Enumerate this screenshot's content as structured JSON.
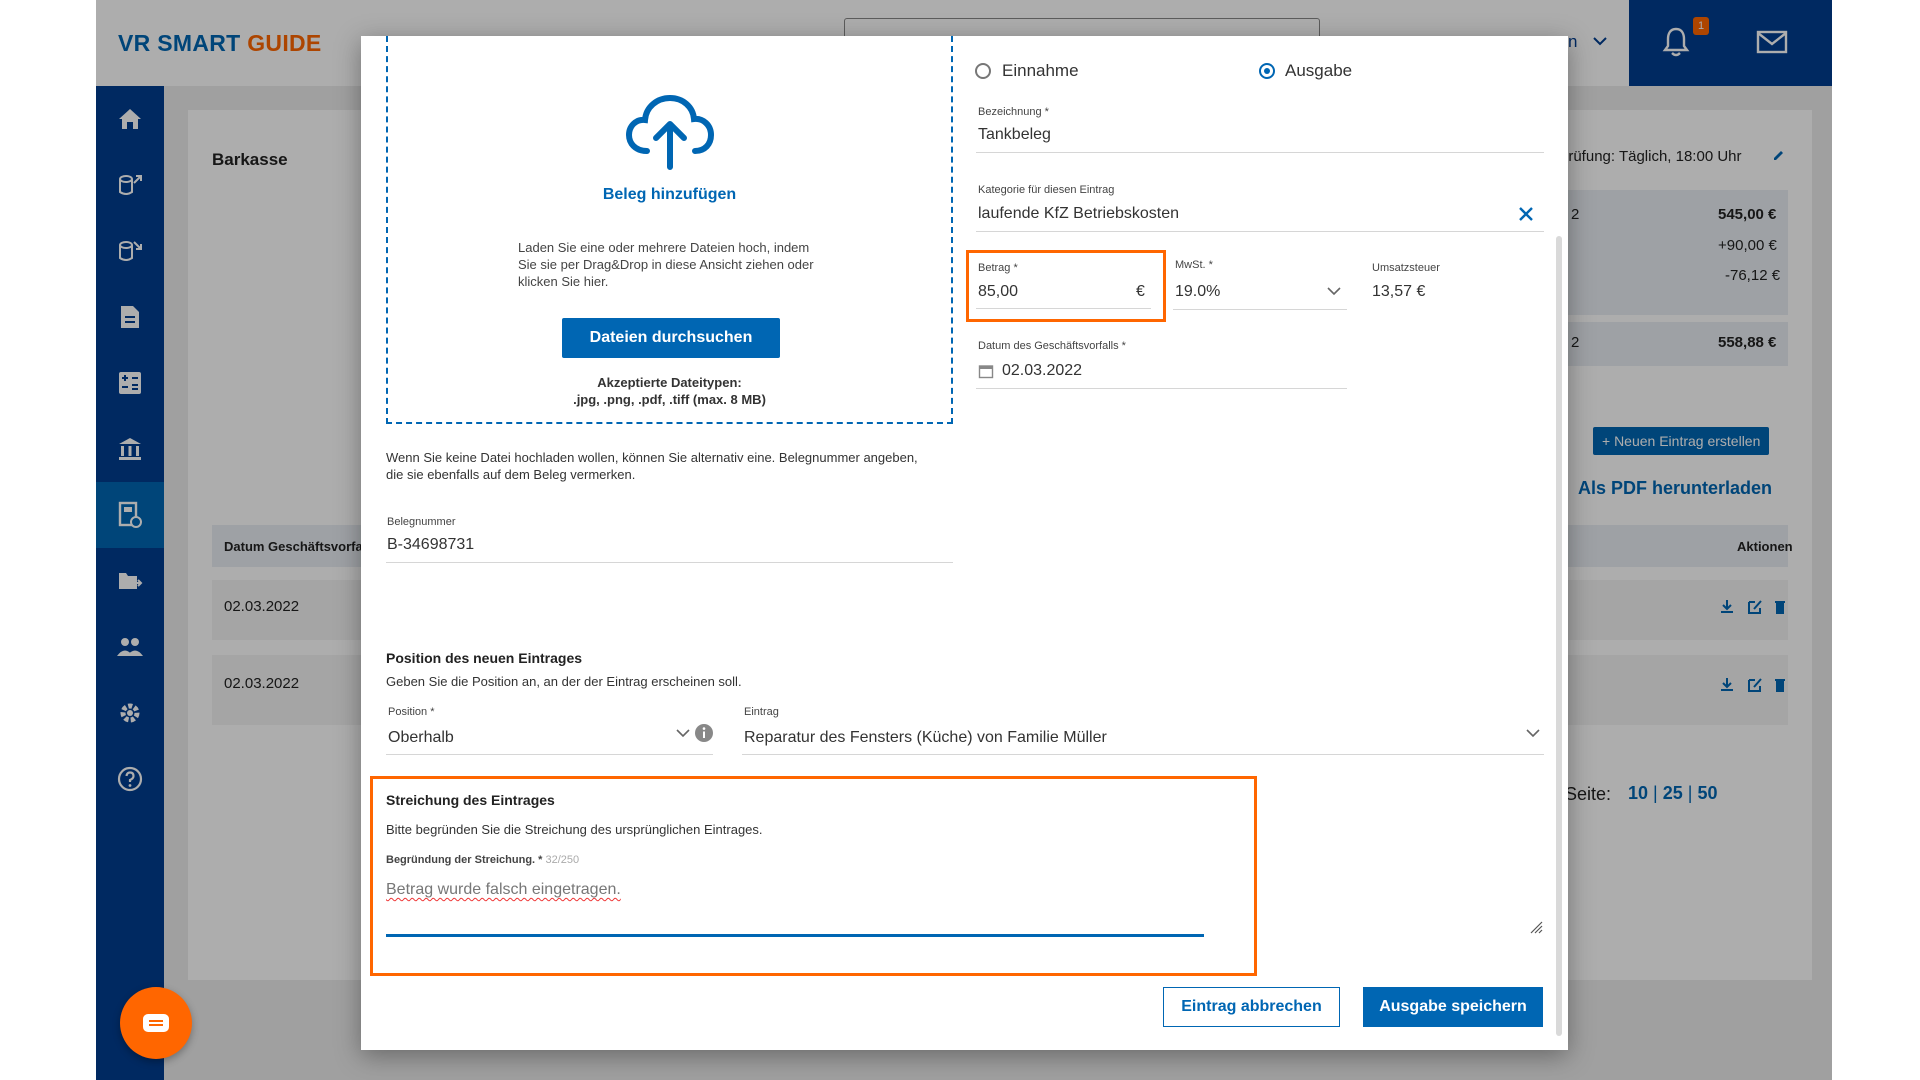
{
  "app": {
    "logo_part1": "VR SMART",
    "logo_part2": "GUIDE",
    "user_truncated": "n",
    "notification_count": "1"
  },
  "background": {
    "page_title": "Barkasse",
    "review_text": "prüfung: Täglich, 18:00 Uhr",
    "summary": [
      {
        "marker": "2",
        "value": "545,00 €"
      },
      {
        "marker": "",
        "value": "+90,00 €"
      },
      {
        "marker": "",
        "value": "-76,12 €"
      },
      {
        "marker": "2",
        "value": "558,88 €"
      }
    ],
    "new_entry_button": "+ Neuen Eintrag erstellen",
    "pdf_link": "Als PDF herunterladen",
    "table_header_date": "Datum Geschäftsvorfal",
    "table_header_actions": "Aktionen",
    "rows": [
      {
        "date": "02.03.2022"
      },
      {
        "date": "02.03.2022"
      }
    ],
    "pagination_label": "Seite:",
    "page_sizes": [
      "10",
      "25",
      "50"
    ]
  },
  "modal": {
    "upload": {
      "title": "Beleg hinzufügen",
      "description": "Laden Sie eine oder mehrere Dateien hoch, indem Sie sie per Drag&Drop in diese Ansicht ziehen oder klicken Sie hier.",
      "browse_button": "Dateien durchsuchen",
      "accepted_title": "Akzeptierte Dateitypen:",
      "accepted_types": ".jpg, .png, .pdf, .tiff (max. 8 MB)"
    },
    "alt_note": "Wenn Sie keine Datei hochladen wollen, können Sie alternativ eine. Belegnummer angeben, die sie ebenfalls auf dem Beleg vermerken.",
    "belegnummer": {
      "label": "Belegnummer",
      "value": "B-34698731"
    },
    "type": {
      "option_income": "Einnahme",
      "option_expense": "Ausgabe",
      "selected": "Ausgabe"
    },
    "bezeichnung": {
      "label": "Bezeichnung *",
      "value": "Tankbeleg"
    },
    "kategorie": {
      "label": "Kategorie für diesen Eintrag",
      "value": "laufende KfZ Betriebskosten"
    },
    "betrag": {
      "label": "Betrag *",
      "value": "85,00",
      "currency": "€"
    },
    "mwst": {
      "label": "MwSt. *",
      "value": "19.0%"
    },
    "umsatzsteuer": {
      "label": "Umsatzsteuer",
      "value": "13,57 €"
    },
    "datum": {
      "label": "Datum des Geschäftsvorfalls *",
      "value": "02.03.2022"
    },
    "position_section": {
      "title": "Position des neuen Eintrages",
      "description": "Geben Sie die Position an, an der der Eintrag erscheinen soll.",
      "position_label": "Position *",
      "position_value": "Oberhalb",
      "eintrag_label": "Eintrag",
      "eintrag_value": "Reparatur des Fensters (Küche) von Familie Müller"
    },
    "streichung": {
      "title": "Streichung des Eintrages",
      "description": "Bitte begründen Sie die Streichung des ursprünglichen Eintrages.",
      "reason_label": "Begründung der Streichung. *",
      "char_count": "32/250",
      "reason_value": "Betrag wurde falsch eingetragen."
    },
    "cancel_button": "Eintrag abbrechen",
    "save_button": "Ausgabe speichern"
  },
  "colors": {
    "brand_blue": "#0066b3",
    "dark_blue": "#003d8f",
    "accent_orange": "#ff6600"
  }
}
